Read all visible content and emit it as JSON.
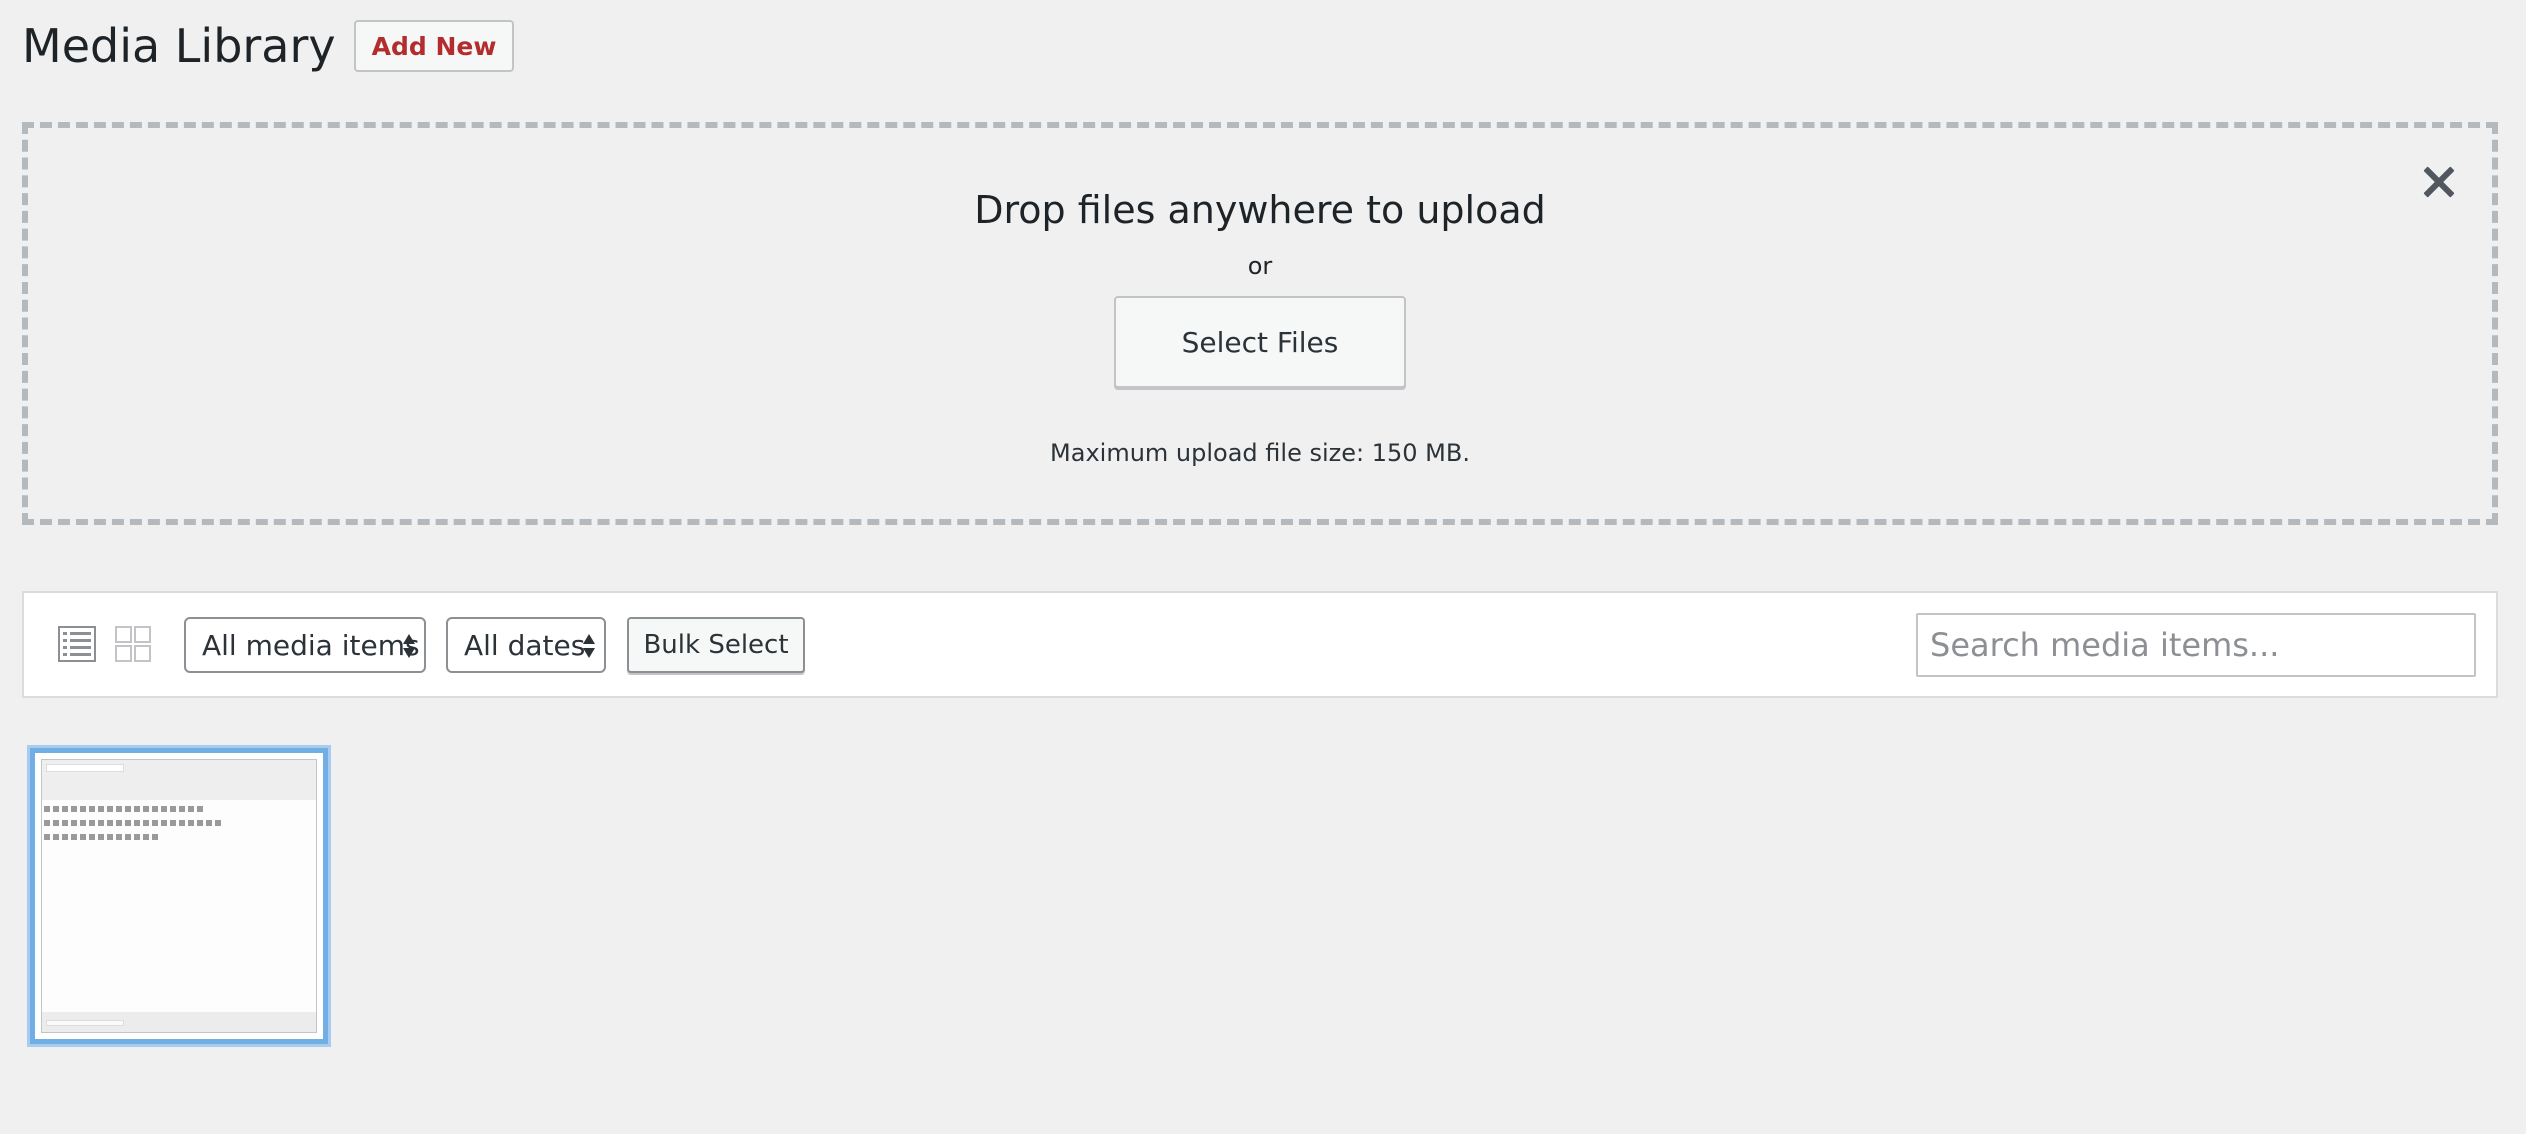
{
  "header": {
    "title": "Media Library",
    "add_new_label": "Add New"
  },
  "uploader": {
    "title": "Drop files anywhere to upload",
    "or_text": "or",
    "select_files_label": "Select Files",
    "max_size_text": "Maximum upload file size: 150 MB."
  },
  "toolbar": {
    "media_filter": "All media items",
    "date_filter": "All dates",
    "bulk_select_label": "Bulk Select",
    "search_placeholder": "Search media items..."
  },
  "colors": {
    "accent": "#b32d2e",
    "selection": "#72aee6",
    "background": "#f0f0f1"
  }
}
